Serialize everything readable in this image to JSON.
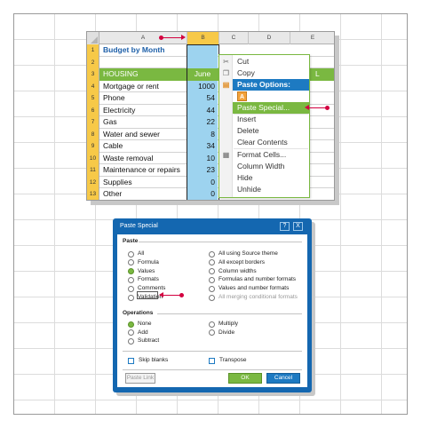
{
  "sheet": {
    "columns": [
      "A",
      "B",
      "C",
      "D",
      "E"
    ],
    "rows": [
      {
        "num": "1",
        "label": "Budget by Month",
        "value": ""
      },
      {
        "num": "2",
        "label": "",
        "value": ""
      },
      {
        "num": "3",
        "label": "HOUSING",
        "value": "June"
      },
      {
        "num": "4",
        "label": "Mortgage or rent",
        "value": "1000"
      },
      {
        "num": "5",
        "label": "Phone",
        "value": "54"
      },
      {
        "num": "6",
        "label": "Electricity",
        "value": "44"
      },
      {
        "num": "7",
        "label": "Gas",
        "value": "22"
      },
      {
        "num": "8",
        "label": "Water and sewer",
        "value": "8"
      },
      {
        "num": "9",
        "label": "Cable",
        "value": "34"
      },
      {
        "num": "10",
        "label": "Waste removal",
        "value": "10"
      },
      {
        "num": "11",
        "label": "Maintenance or repairs",
        "value": "23"
      },
      {
        "num": "12",
        "label": "Supplies",
        "value": "0"
      },
      {
        "num": "13",
        "label": "Other",
        "value": "0"
      }
    ],
    "hidden_col_fragment": "L"
  },
  "context_menu": {
    "items": [
      {
        "label": "Cut",
        "icon": "scissors-icon"
      },
      {
        "label": "Copy",
        "icon": "copy-icon"
      },
      {
        "label": "Paste Options:",
        "icon": "clipboard-icon",
        "header": true
      },
      {
        "label": "A",
        "icon": "",
        "paste_a": true
      },
      {
        "label": "Paste Special...",
        "icon": "",
        "highlight": true
      },
      {
        "label": "Insert",
        "icon": ""
      },
      {
        "label": "Delete",
        "icon": ""
      },
      {
        "label": "Clear Contents",
        "icon": ""
      },
      {
        "label": "Format Cells...",
        "icon": "format-cells-icon"
      },
      {
        "label": "Column Width",
        "icon": ""
      },
      {
        "label": "Hide",
        "icon": ""
      },
      {
        "label": "Unhide",
        "icon": ""
      }
    ]
  },
  "dialog": {
    "title": "Paste Special",
    "help": "?",
    "close": "X",
    "paste_section": "Paste",
    "paste_left": [
      "All",
      "Formula",
      "Values",
      "Formats",
      "Comments",
      "Validation"
    ],
    "paste_right": [
      "All using Source theme",
      "All except borders",
      "Column widths",
      "Formulas and number formats",
      "Values and number formats",
      "All merging conditional formats"
    ],
    "paste_selected": "Values",
    "operations_section": "Operations",
    "ops_left": [
      "None",
      "Add",
      "Subtract"
    ],
    "ops_right": [
      "Multiply",
      "Divide"
    ],
    "ops_selected": "None",
    "skip_blanks": "Skip blanks",
    "transpose": "Transpose",
    "paste_link": "Paste Link",
    "ok": "OK",
    "cancel": "Cancel"
  },
  "colors": {
    "accent_green": "#7ab841",
    "accent_blue": "#1d7ac2",
    "dialog_blue": "#1467b0",
    "row_header_yellow": "#f7c948",
    "selection_blue": "#9dd3ef",
    "callout_red": "#d3003f"
  }
}
